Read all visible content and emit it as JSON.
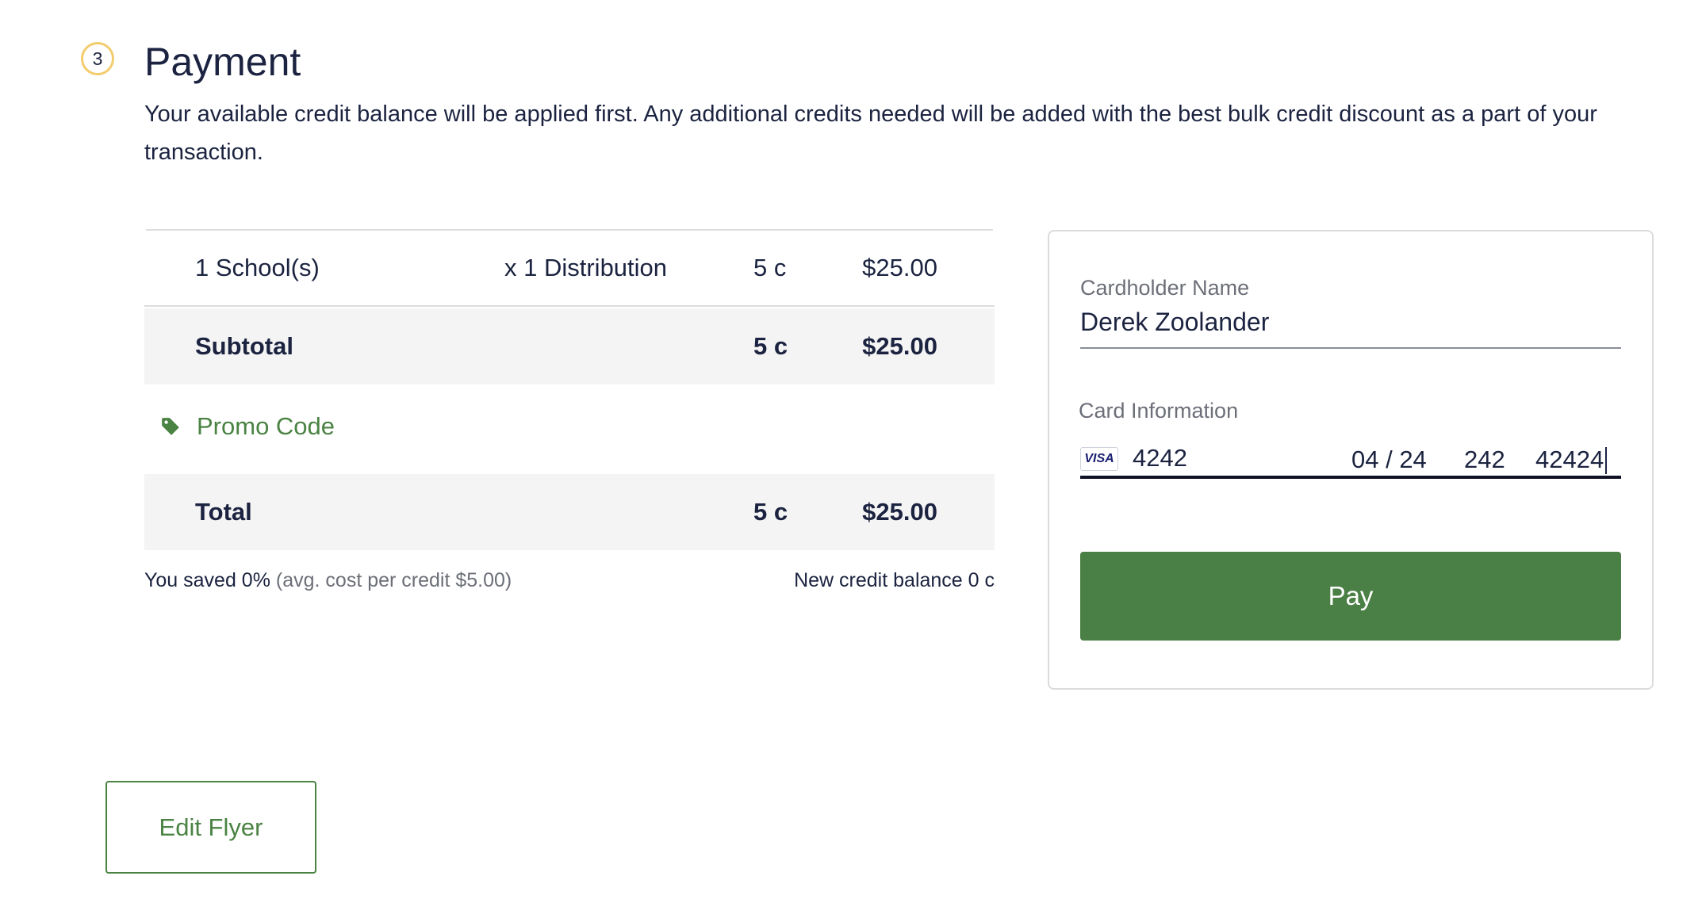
{
  "section": {
    "step_number": "3",
    "title": "Payment",
    "description": "Your available credit balance will be applied first. Any additional credits needed will be added with the best bulk credit discount as a part of your transaction."
  },
  "order": {
    "item": {
      "name": "1 School(s)",
      "multiplier": "x 1 Distribution",
      "credits": "5 c",
      "price": "$25.00"
    },
    "subtotal": {
      "label": "Subtotal",
      "credits": "5 c",
      "price": "$25.00"
    },
    "promo": {
      "label": "Promo Code",
      "icon": "tag-icon"
    },
    "total": {
      "label": "Total",
      "credits": "5 c",
      "price": "$25.00"
    },
    "saved_text": "You saved 0%",
    "avg_cost_text": "(avg. cost per credit $5.00)",
    "new_balance_text": "New credit balance 0 c"
  },
  "card_form": {
    "cardholder_label": "Cardholder Name",
    "cardholder_value": "Derek Zoolander",
    "card_info_label": "Card Information",
    "card_brand": "VISA",
    "card_number": "4242",
    "expiry": "04 / 24",
    "cvc": "242",
    "zip": "42424",
    "pay_label": "Pay"
  },
  "actions": {
    "edit_flyer_label": "Edit Flyer"
  },
  "colors": {
    "accent_green": "#4a7f45",
    "step_badge": "#f3cc6e",
    "text_dark": "#1b2340",
    "row_bg": "#f4f4f4"
  }
}
